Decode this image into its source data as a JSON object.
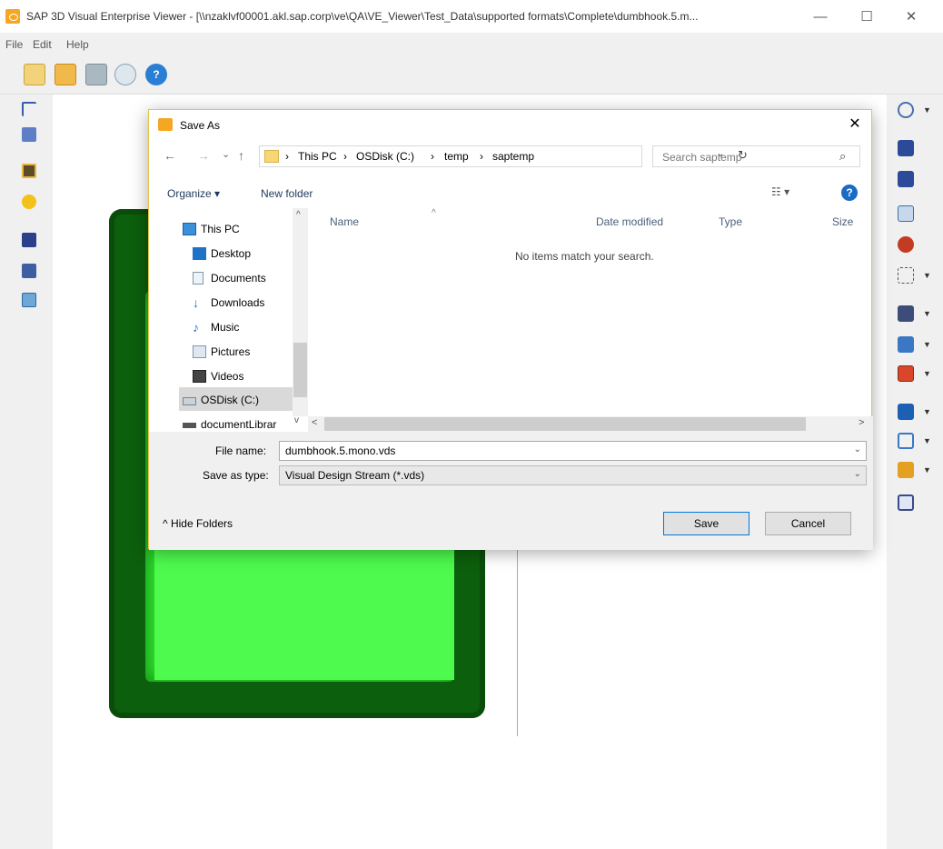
{
  "app": {
    "title": "SAP 3D Visual Enterprise Viewer - [\\\\nzaklvf00001.akl.sap.corp\\ve\\QA\\VE_Viewer\\Test_Data\\supported formats\\Complete\\dumbhook.5.m...",
    "minimize": "—",
    "maximize": "☐",
    "close": "✕"
  },
  "menu": {
    "file": "File",
    "edit": "Edit",
    "help": "Help"
  },
  "dialog": {
    "title": "Save As",
    "close": "✕",
    "nav": {
      "back": "←",
      "forward": "→",
      "recent": "⌄",
      "up": "↑"
    },
    "address": {
      "sep": "›",
      "crumbs": [
        "This PC",
        "OSDisk (C:)",
        "temp",
        "saptemp"
      ],
      "dropdown": "⌄",
      "refresh": "↻"
    },
    "search": {
      "placeholder": "Search saptemp",
      "icon": "⌕"
    },
    "toolbar": {
      "organize": "Organize ▾",
      "new_folder": "New folder",
      "view": "☷ ▾",
      "help": "?"
    },
    "nav_pane": {
      "items": [
        {
          "label": "This PC",
          "icon": "computer-icon"
        },
        {
          "label": "Desktop",
          "icon": "desktop-icon"
        },
        {
          "label": "Documents",
          "icon": "documents-icon"
        },
        {
          "label": "Downloads",
          "icon": "downloads-icon"
        },
        {
          "label": "Music",
          "icon": "music-icon"
        },
        {
          "label": "Pictures",
          "icon": "pictures-icon"
        },
        {
          "label": "Videos",
          "icon": "videos-icon"
        },
        {
          "label": "OSDisk (C:)",
          "icon": "drive-icon"
        },
        {
          "label": "documentLibrar",
          "icon": "network-drive-icon"
        }
      ],
      "selected": "OSDisk (C:)"
    },
    "columns": {
      "name": "Name",
      "date": "Date modified",
      "type": "Type",
      "size": "Size"
    },
    "empty_message": "No items match your search.",
    "file_name_label": "File name:",
    "file_name_value": "dumbhook.5.mono.vds",
    "save_type_label": "Save as type:",
    "save_type_value": "Visual Design Stream (*.vds)",
    "hide_folders": "^ Hide Folders",
    "save": "Save",
    "cancel": "Cancel"
  },
  "colors": {
    "accent": "#0078d7",
    "model_dark": "#0c5f0c",
    "model_light": "#4dfa4d",
    "dialog_border": "#e6c44a"
  }
}
